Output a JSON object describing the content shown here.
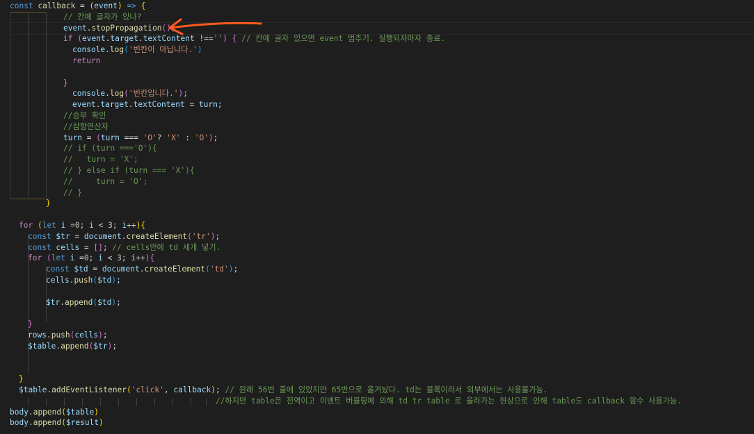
{
  "editor": {
    "language": "javascript",
    "theme": "dark",
    "annotation": {
      "kind": "orange-arrow",
      "color": "#ff5a1f"
    },
    "lines": [
      {
        "indent": 0,
        "tokens": [
          [
            "kw",
            "const "
          ],
          [
            "fn",
            "callback"
          ],
          [
            "pl",
            " = "
          ],
          [
            "br1",
            "("
          ],
          [
            "var",
            "event"
          ],
          [
            "br1",
            ")"
          ],
          [
            "kw",
            " => "
          ],
          [
            "br1",
            "{"
          ]
        ]
      },
      {
        "indent": 1,
        "tokens": [
          [
            "cm",
            "// 칸에 글자가 있나?"
          ]
        ]
      },
      {
        "indent": 1,
        "tokens": [
          [
            "var",
            "event"
          ],
          [
            "pl",
            "."
          ],
          [
            "fn",
            "stopPropagation"
          ],
          [
            "br2",
            "()"
          ],
          [
            "pl",
            ";"
          ]
        ]
      },
      {
        "indent": 1,
        "tokens": [
          [
            "ctl",
            "if "
          ],
          [
            "br2",
            "("
          ],
          [
            "var",
            "event"
          ],
          [
            "pl",
            "."
          ],
          [
            "var",
            "target"
          ],
          [
            "pl",
            "."
          ],
          [
            "var",
            "textContent"
          ],
          [
            "pl",
            " !=="
          ],
          [
            "str",
            "''"
          ],
          [
            "br2",
            ")"
          ],
          [
            "pl",
            " "
          ],
          [
            "br2",
            "{"
          ],
          [
            "pl",
            " "
          ],
          [
            "cm",
            "// 칸에 글자 있으면 event 멈추기. 실행되자마자 종료."
          ]
        ]
      },
      {
        "indent": 2,
        "tokens": [
          [
            "var",
            "console"
          ],
          [
            "pl",
            "."
          ],
          [
            "fn",
            "log"
          ],
          [
            "br3",
            "("
          ],
          [
            "str",
            "'빈칸이 아닙니다.'"
          ],
          [
            "br3",
            ")"
          ]
        ]
      },
      {
        "indent": 2,
        "tokens": [
          [
            "ctl",
            "return"
          ]
        ]
      },
      {
        "indent": 0,
        "tokens": []
      },
      {
        "indent": 1,
        "tokens": [
          [
            "br2",
            "}"
          ]
        ]
      },
      {
        "indent": 2,
        "tokens": [
          [
            "var",
            "console"
          ],
          [
            "pl",
            "."
          ],
          [
            "fn",
            "log"
          ],
          [
            "br2",
            "("
          ],
          [
            "str",
            "'빈칸입니다.'"
          ],
          [
            "br2",
            ")"
          ],
          [
            "pl",
            ";"
          ]
        ]
      },
      {
        "indent": 2,
        "tokens": [
          [
            "var",
            "event"
          ],
          [
            "pl",
            "."
          ],
          [
            "var",
            "target"
          ],
          [
            "pl",
            "."
          ],
          [
            "var",
            "textContent"
          ],
          [
            "pl",
            " = "
          ],
          [
            "var",
            "turn"
          ],
          [
            "pl",
            ";"
          ]
        ]
      },
      {
        "indent": 1,
        "tokens": [
          [
            "cm",
            "//승부 확인"
          ]
        ]
      },
      {
        "indent": 1,
        "tokens": [
          [
            "cm",
            "//삼항연산자"
          ]
        ]
      },
      {
        "indent": 1,
        "tokens": [
          [
            "var",
            "turn"
          ],
          [
            "pl",
            " = "
          ],
          [
            "br2",
            "("
          ],
          [
            "var",
            "turn"
          ],
          [
            "pl",
            " === "
          ],
          [
            "str",
            "'O'"
          ],
          [
            "pl",
            "? "
          ],
          [
            "str",
            "'X'"
          ],
          [
            "pl",
            " : "
          ],
          [
            "str",
            "'O'"
          ],
          [
            "br2",
            ")"
          ],
          [
            "pl",
            ";"
          ]
        ]
      },
      {
        "indent": 1,
        "tokens": [
          [
            "cm",
            "// if (turn ==='O'){"
          ]
        ]
      },
      {
        "indent": 1,
        "tokens": [
          [
            "cm",
            "//   turn = 'X';"
          ]
        ]
      },
      {
        "indent": 1,
        "tokens": [
          [
            "cm",
            "// } else if (turn === 'X'){"
          ]
        ]
      },
      {
        "indent": 1,
        "tokens": [
          [
            "cm",
            "//     turn = 'O';"
          ]
        ]
      },
      {
        "indent": 1,
        "tokens": [
          [
            "cm",
            "// }"
          ]
        ]
      },
      {
        "indent": 0,
        "tokens": [
          [
            "br1",
            "}"
          ]
        ],
        "offset": 66
      },
      {
        "indent": 0,
        "tokens": []
      },
      {
        "indent": 0,
        "tokens": [
          [
            "ctl",
            "for "
          ],
          [
            "br1",
            "("
          ],
          [
            "kw",
            "let "
          ],
          [
            "var",
            "i"
          ],
          [
            "pl",
            " ="
          ],
          [
            "num",
            "0"
          ],
          [
            "pl",
            "; "
          ],
          [
            "var",
            "i"
          ],
          [
            "pl",
            " < "
          ],
          [
            "num",
            "3"
          ],
          [
            "pl",
            "; "
          ],
          [
            "var",
            "i"
          ],
          [
            "pl",
            "++"
          ],
          [
            "br1",
            ")"
          ],
          [
            "br1",
            "{"
          ]
        ],
        "offset": 27
      },
      {
        "indent": 0,
        "tokens": [
          [
            "kw",
            "const "
          ],
          [
            "var",
            "$tr"
          ],
          [
            "pl",
            " = "
          ],
          [
            "var",
            "document"
          ],
          [
            "pl",
            "."
          ],
          [
            "fn",
            "createElement"
          ],
          [
            "br2",
            "("
          ],
          [
            "str",
            "'tr'"
          ],
          [
            "br2",
            ")"
          ],
          [
            "pl",
            ";"
          ]
        ],
        "offset": 40
      },
      {
        "indent": 0,
        "tokens": [
          [
            "kw",
            "const "
          ],
          [
            "var",
            "cells"
          ],
          [
            "pl",
            " = "
          ],
          [
            "br2",
            "[]"
          ],
          [
            "pl",
            "; "
          ],
          [
            "cm",
            "// cells안에 td 세개 넣기."
          ]
        ],
        "offset": 40
      },
      {
        "indent": 0,
        "tokens": [
          [
            "ctl",
            "for "
          ],
          [
            "br2",
            "("
          ],
          [
            "kw",
            "let "
          ],
          [
            "var",
            "i"
          ],
          [
            "pl",
            " ="
          ],
          [
            "num",
            "0"
          ],
          [
            "pl",
            "; "
          ],
          [
            "var",
            "i"
          ],
          [
            "pl",
            " < "
          ],
          [
            "num",
            "3"
          ],
          [
            "pl",
            "; "
          ],
          [
            "var",
            "i"
          ],
          [
            "pl",
            "++"
          ],
          [
            "br2",
            ")"
          ],
          [
            "br2",
            "{"
          ]
        ],
        "offset": 40
      },
      {
        "indent": 0,
        "tokens": [
          [
            "kw",
            "const "
          ],
          [
            "var",
            "$td"
          ],
          [
            "pl",
            " = "
          ],
          [
            "var",
            "document"
          ],
          [
            "pl",
            "."
          ],
          [
            "fn",
            "createElement"
          ],
          [
            "br3",
            "("
          ],
          [
            "str",
            "'td'"
          ],
          [
            "br3",
            ")"
          ],
          [
            "pl",
            ";"
          ]
        ],
        "offset": 66
      },
      {
        "indent": 0,
        "tokens": [
          [
            "var",
            "cells"
          ],
          [
            "pl",
            "."
          ],
          [
            "fn",
            "push"
          ],
          [
            "br3",
            "("
          ],
          [
            "var",
            "$td"
          ],
          [
            "br3",
            ")"
          ],
          [
            "pl",
            ";"
          ]
        ],
        "offset": 66
      },
      {
        "indent": 0,
        "tokens": []
      },
      {
        "indent": 0,
        "tokens": [
          [
            "var",
            "$tr"
          ],
          [
            "pl",
            "."
          ],
          [
            "fn",
            "append"
          ],
          [
            "br3",
            "("
          ],
          [
            "var",
            "$td"
          ],
          [
            "br3",
            ")"
          ],
          [
            "pl",
            ";"
          ]
        ],
        "offset": 66
      },
      {
        "indent": 0,
        "tokens": []
      },
      {
        "indent": 0,
        "tokens": [
          [
            "br2",
            "}"
          ]
        ],
        "offset": 40
      },
      {
        "indent": 0,
        "tokens": [
          [
            "var",
            "rows"
          ],
          [
            "pl",
            "."
          ],
          [
            "fn",
            "push"
          ],
          [
            "br2",
            "("
          ],
          [
            "var",
            "cells"
          ],
          [
            "br2",
            ")"
          ],
          [
            "pl",
            ";"
          ]
        ],
        "offset": 40
      },
      {
        "indent": 0,
        "tokens": [
          [
            "var",
            "$table"
          ],
          [
            "pl",
            "."
          ],
          [
            "fn",
            "append"
          ],
          [
            "br2",
            "("
          ],
          [
            "var",
            "$tr"
          ],
          [
            "br2",
            ")"
          ],
          [
            "pl",
            ";"
          ]
        ],
        "offset": 40
      },
      {
        "indent": 0,
        "tokens": []
      },
      {
        "indent": 0,
        "tokens": []
      },
      {
        "indent": 0,
        "tokens": [
          [
            "br1",
            "}"
          ]
        ],
        "offset": 27
      },
      {
        "indent": 0,
        "tokens": [
          [
            "var",
            "$table"
          ],
          [
            "pl",
            "."
          ],
          [
            "fn",
            "addEventListener"
          ],
          [
            "br1",
            "("
          ],
          [
            "str",
            "'click'"
          ],
          [
            "pl",
            ", "
          ],
          [
            "var",
            "callback"
          ],
          [
            "br1",
            ")"
          ],
          [
            "pl",
            "; "
          ],
          [
            "cm",
            "// 원래 56번 줄에 있었지만 65번으로 옮겨놨다. td는 블록이라서 외부에서는 사용불가능."
          ]
        ],
        "offset": 27
      },
      {
        "indent": 0,
        "tokens": [
          [
            "cm",
            "//하지만 table은 전역이고 이벤트 버블링에 의해 td tr table 로 올라가는 현상으로 인해 table도 callback 함수 사용가능."
          ]
        ],
        "offset": 310
      },
      {
        "indent": 0,
        "tokens": [
          [
            "var",
            "body"
          ],
          [
            "pl",
            "."
          ],
          [
            "fn",
            "append"
          ],
          [
            "br1",
            "("
          ],
          [
            "var",
            "$table"
          ],
          [
            "br1",
            ")"
          ]
        ]
      },
      {
        "indent": 0,
        "tokens": [
          [
            "var",
            "body"
          ],
          [
            "pl",
            "."
          ],
          [
            "fn",
            "append"
          ],
          [
            "br1",
            "("
          ],
          [
            "var",
            "$result"
          ],
          [
            "br1",
            ")"
          ]
        ]
      }
    ]
  }
}
